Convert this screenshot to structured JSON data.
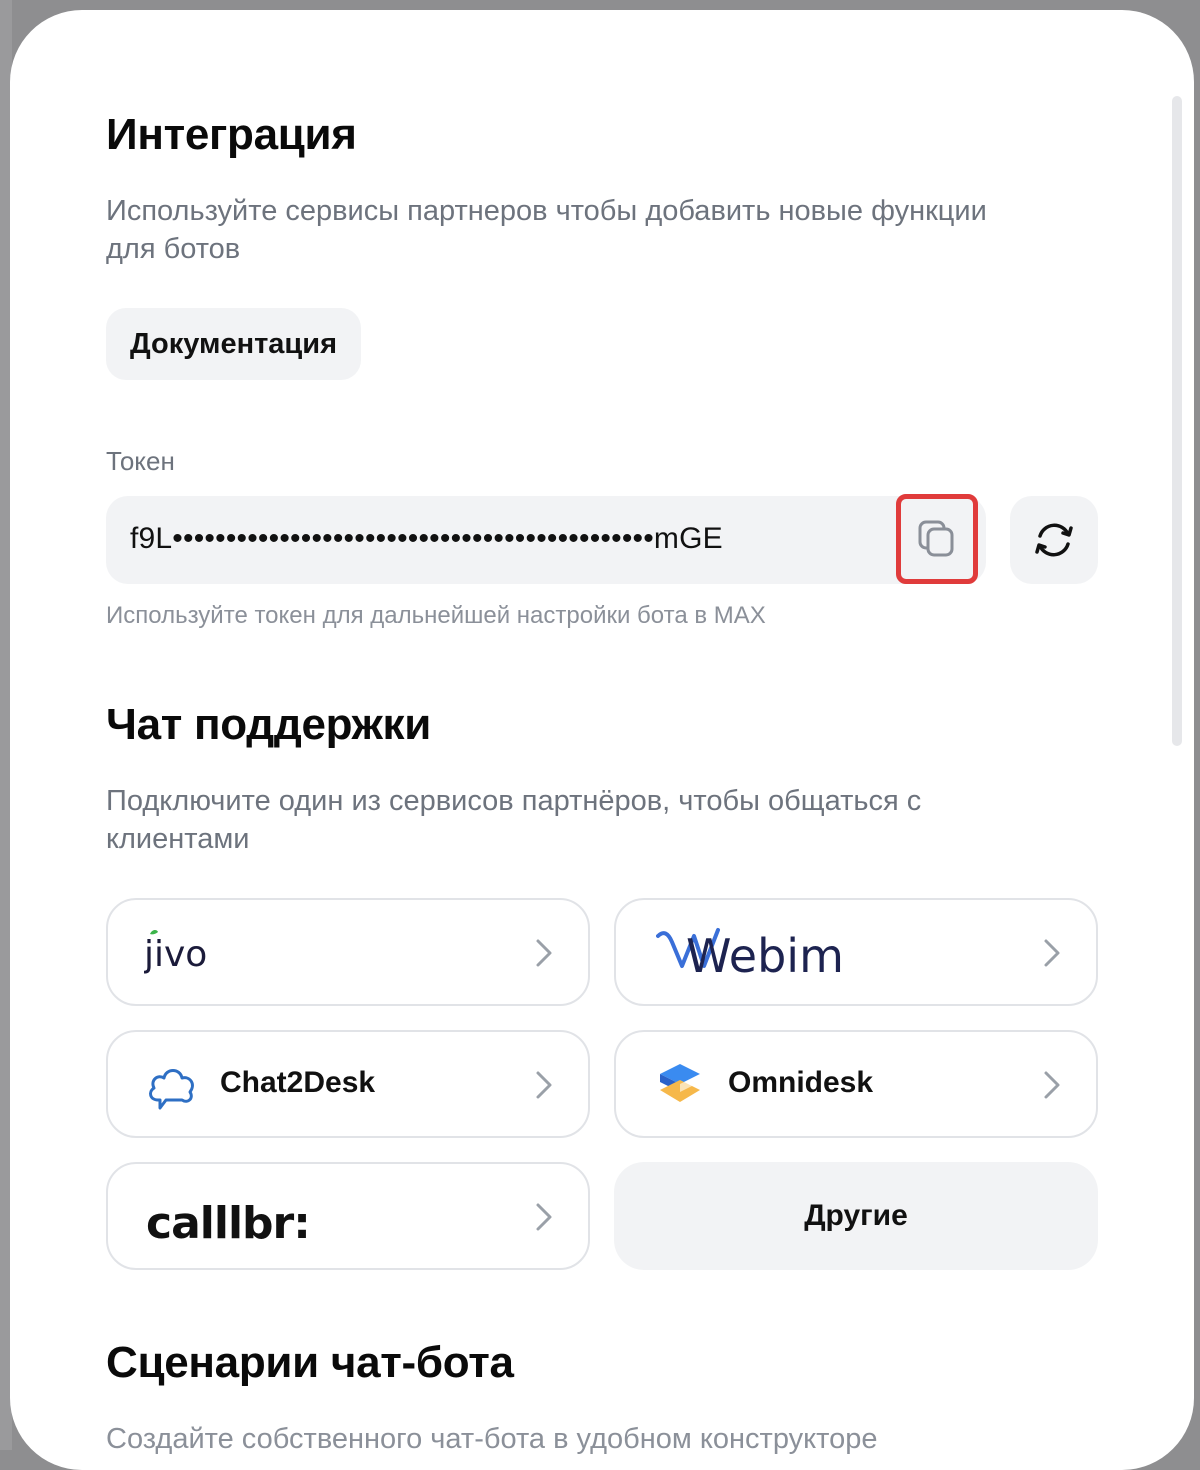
{
  "integration": {
    "title": "Интеграция",
    "subtitle": "Используйте сервисы партнеров чтобы добавить новые функции для ботов",
    "docs_button": "Документация"
  },
  "token": {
    "label": "Токен",
    "value": "f9L•••••••••••••••••••••••••••••••••••••••••••••mGE",
    "hint": "Используйте токен для дальнейшей настройки бота в MAX",
    "copy_icon": "copy-icon",
    "refresh_icon": "refresh-icon"
  },
  "support_chat": {
    "title": "Чат поддержки",
    "subtitle": "Подключите один из сервисов партнёров, чтобы общаться с клиентами",
    "partners": [
      {
        "name": "jivo"
      },
      {
        "name": "Webim"
      },
      {
        "name": "Chat2Desk"
      },
      {
        "name": "Omnidesk"
      },
      {
        "name": "calllbr:"
      }
    ],
    "others_button": "Другие"
  },
  "scenarios": {
    "title": "Сценарии чат-бота",
    "subtitle": "Создайте собственного чат-бота в удобном конструкторе"
  },
  "colors": {
    "highlight": "#e03b3b",
    "muted_text": "#6d737d",
    "field_bg": "#f2f3f5"
  }
}
